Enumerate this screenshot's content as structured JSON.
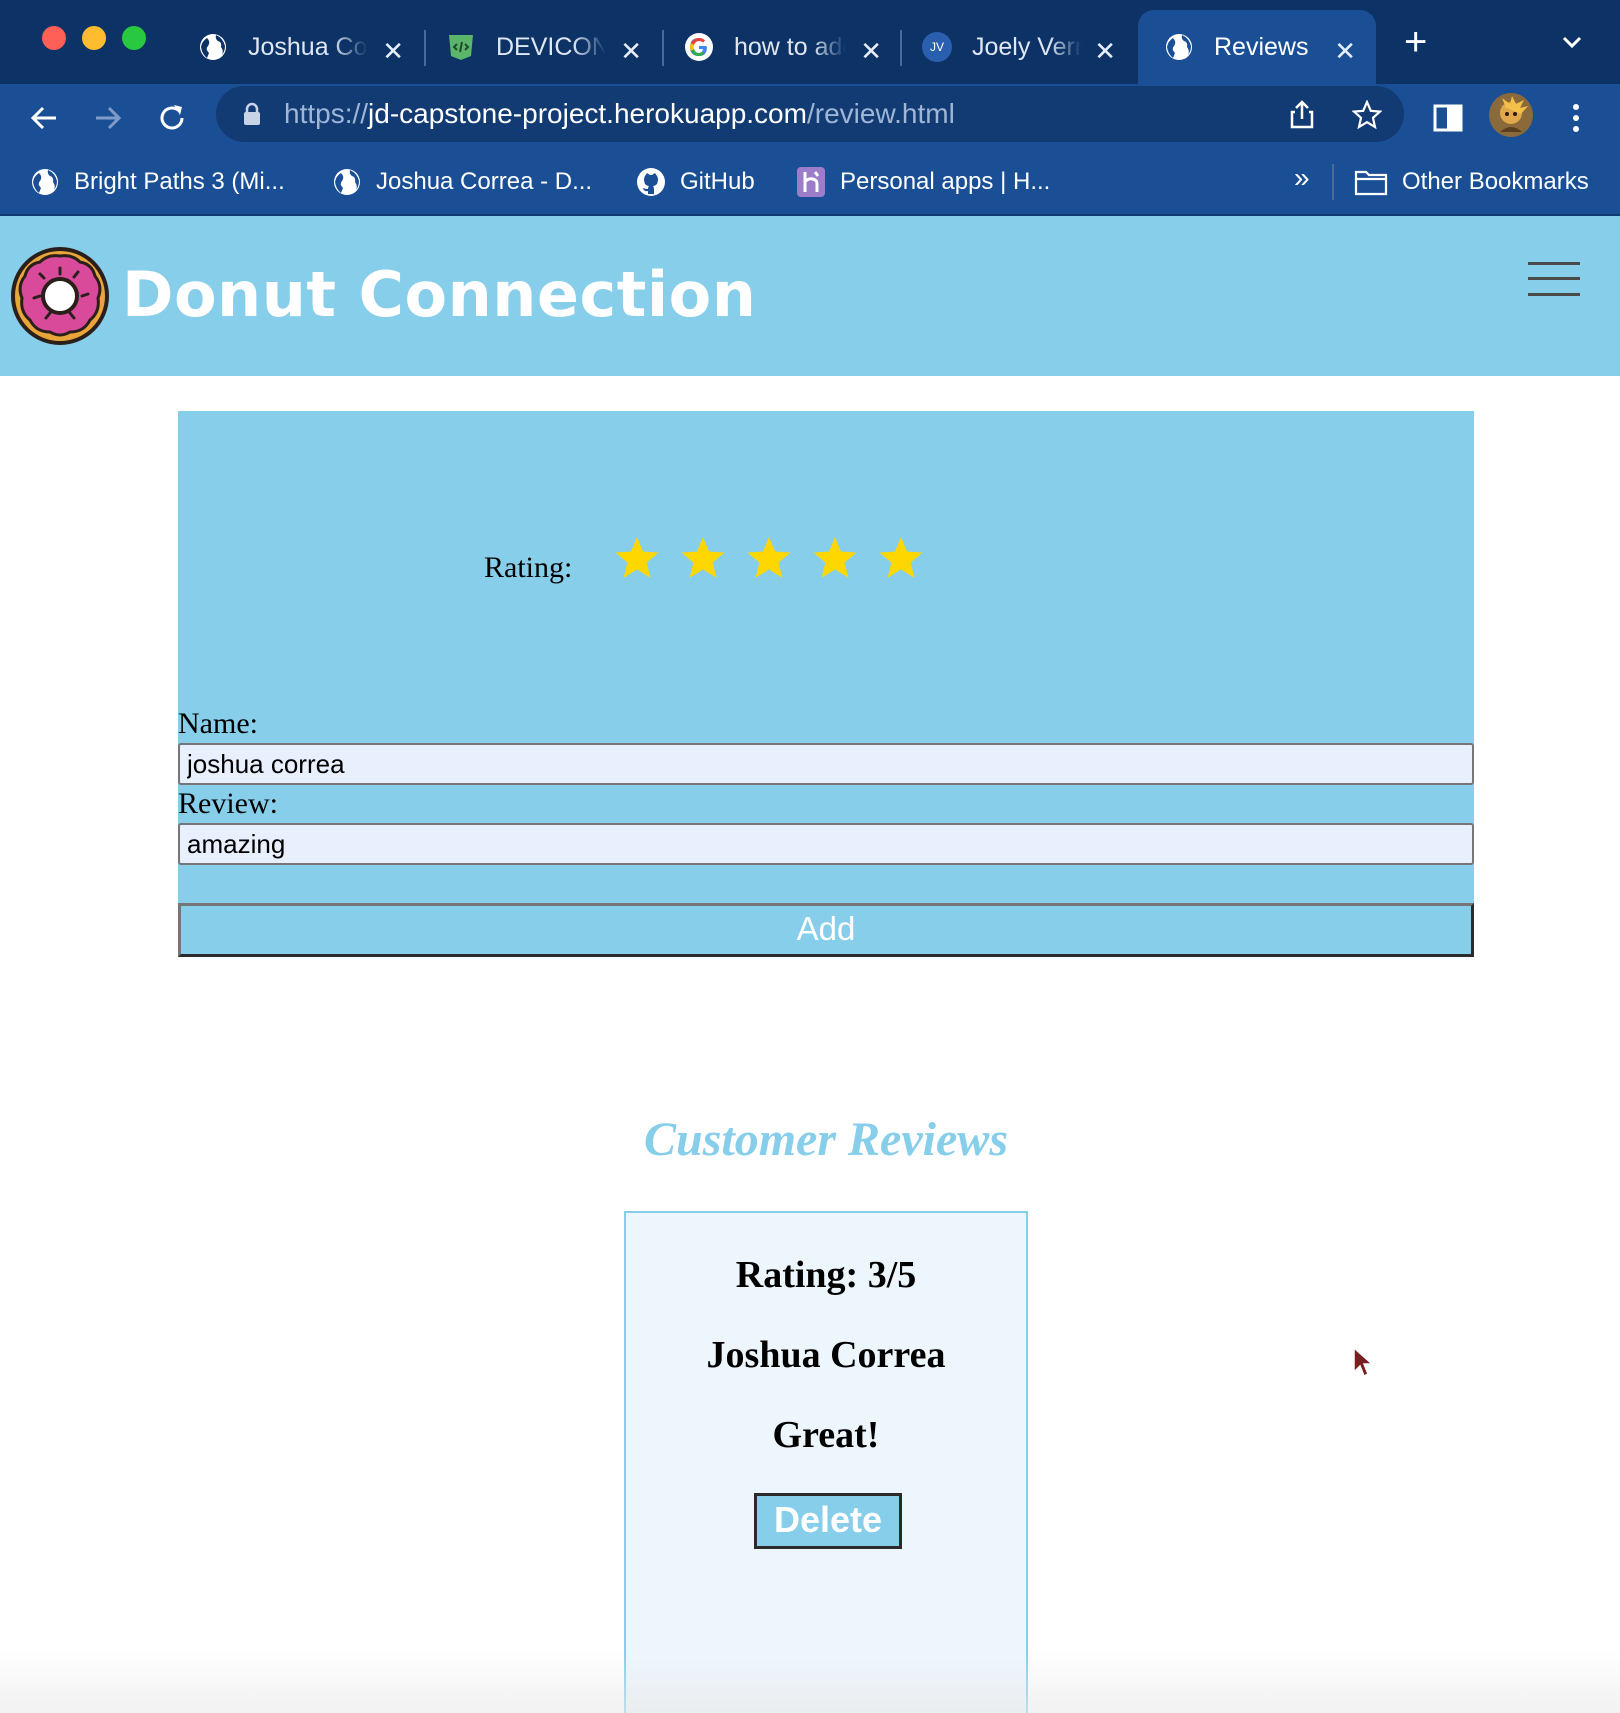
{
  "browser": {
    "tabs": [
      {
        "title": "Joshua Correa",
        "icon": "globe-icon",
        "active": false
      },
      {
        "title": "DEVICON",
        "icon": "devicon-shield-icon",
        "active": false
      },
      {
        "title": "how to add",
        "icon": "google-icon",
        "active": false
      },
      {
        "title": "Joely Verna",
        "icon": "jv-avatar-icon",
        "favicon_text": "JV",
        "active": false
      },
      {
        "title": "Reviews",
        "icon": "globe-icon",
        "active": true
      }
    ],
    "address": {
      "scheme": "https://",
      "host": "jd-capstone-project.herokuapp.com",
      "path": "/review.html"
    },
    "bookmarks": [
      {
        "label": "Bright Paths 3 (Mi...",
        "icon": "globe-icon"
      },
      {
        "label": "Joshua Correa - D...",
        "icon": "globe-icon"
      },
      {
        "label": "GitHub",
        "icon": "github-icon"
      },
      {
        "label": "Personal apps | H...",
        "icon": "heroku-icon"
      }
    ],
    "bookmarks_overflow": "»",
    "other_bookmarks": "Other Bookmarks"
  },
  "site": {
    "brand": "Donut Connection"
  },
  "form": {
    "rating_label": "Rating:",
    "star_count": 5,
    "star_color": "#ffd700",
    "name_label": "Name:",
    "name_value": "joshua correa",
    "review_label": "Review:",
    "review_value": "amazing",
    "add_label": "Add"
  },
  "reviews": {
    "title": "Customer Reviews",
    "items": [
      {
        "rating": "Rating: 3/5",
        "name": "Joshua Correa",
        "text": "Great!",
        "delete_label": "Delete"
      }
    ]
  },
  "colors": {
    "accent": "#87ceeb",
    "tab_strip": "#0c3266",
    "toolbar": "#1a4f96"
  }
}
